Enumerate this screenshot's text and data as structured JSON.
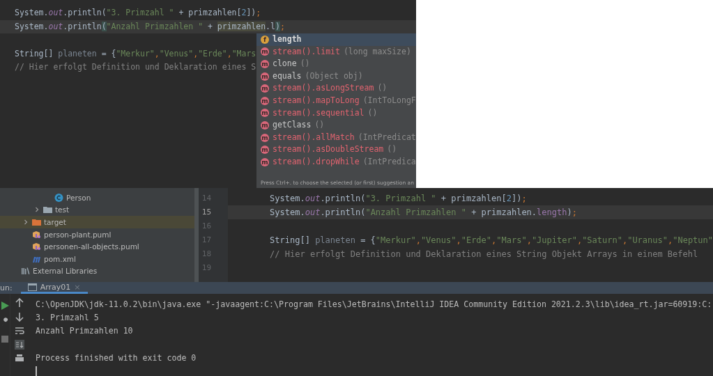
{
  "top_editor": {
    "lines": [
      {
        "current": false,
        "tokens": [
          {
            "t": "System.",
            "kind": "plain"
          },
          {
            "t": "out",
            "kind": "field"
          },
          {
            "t": ".println(",
            "kind": "plain"
          },
          {
            "t": "\"3. Primzahl \"",
            "kind": "string"
          },
          {
            "t": " + primzahlen[",
            "kind": "plain"
          },
          {
            "t": "2",
            "kind": "number"
          },
          {
            "t": "])",
            "kind": "plain"
          },
          {
            "t": ";",
            "kind": "punct"
          }
        ]
      },
      {
        "current": true,
        "tokens": [
          {
            "t": "System.",
            "kind": "plain"
          },
          {
            "t": "out",
            "kind": "field"
          },
          {
            "t": ".println",
            "kind": "plain"
          },
          {
            "t": "(",
            "kind": "brace"
          },
          {
            "t": "\"Anzahl Primzahlen \"",
            "kind": "string"
          },
          {
            "t": " + ",
            "kind": "plain"
          },
          {
            "t": "primzahlen",
            "kind": "highlight"
          },
          {
            "t": ".l",
            "kind": "plain"
          },
          {
            "t": ")",
            "kind": "brace"
          },
          {
            "t": ";",
            "kind": "punct"
          }
        ]
      },
      {
        "current": false
      },
      {
        "current": false,
        "tokens": [
          {
            "t": "String[] ",
            "kind": "plain"
          },
          {
            "t": "planeten",
            "kind": "unused"
          },
          {
            "t": " = {",
            "kind": "plain"
          },
          {
            "t": "\"Merkur\"",
            "kind": "string"
          },
          {
            "t": ",",
            "kind": "punct"
          },
          {
            "t": "\"Venus\"",
            "kind": "string"
          },
          {
            "t": ",",
            "kind": "punct"
          },
          {
            "t": "\"Erde\"",
            "kind": "string"
          },
          {
            "t": ",",
            "kind": "punct"
          },
          {
            "t": "\"Mars",
            "kind": "string"
          }
        ]
      },
      {
        "current": false,
        "tokens": [
          {
            "t": "// Hier erfolgt Definition und Deklaration eines S",
            "kind": "comment"
          }
        ]
      }
    ]
  },
  "completion_popup": {
    "items": [
      {
        "icon": "f",
        "kind": "field",
        "selected": true,
        "name": "length"
      },
      {
        "icon": "m",
        "kind": "stream",
        "selected": false,
        "name": "stream().limit",
        "params": "(long maxSize)"
      },
      {
        "icon": "m",
        "kind": "member",
        "selected": false,
        "name": "clone",
        "params": "()"
      },
      {
        "icon": "m",
        "kind": "member",
        "selected": false,
        "name": "equals",
        "params": "(Object obj)"
      },
      {
        "icon": "m",
        "kind": "stream",
        "selected": false,
        "name": "stream().asLongStream",
        "params": "()"
      },
      {
        "icon": "m",
        "kind": "stream",
        "selected": false,
        "name": "stream().mapToLong",
        "params": "(IntToLongF"
      },
      {
        "icon": "m",
        "kind": "stream",
        "selected": false,
        "name": "stream().sequential",
        "params": "()"
      },
      {
        "icon": "m",
        "kind": "member",
        "selected": false,
        "name": "getClass",
        "params": "()"
      },
      {
        "icon": "m",
        "kind": "stream",
        "selected": false,
        "name": "stream().allMatch",
        "params": "(IntPredicat"
      },
      {
        "icon": "m",
        "kind": "stream",
        "selected": false,
        "name": "stream().asDoubleStream",
        "params": "()"
      },
      {
        "icon": "m",
        "kind": "stream",
        "selected": false,
        "name": "stream().dropWhile",
        "params": "(IntPredica"
      }
    ],
    "hint": "Press Ctrl+. to choose the selected (or first) suggestion an"
  },
  "project_tree": {
    "items": [
      {
        "children": [
          {
            "children": [
              {
                "children": [
                  {
                    "kind": "class",
                    "label": "Person",
                    "selected": false
                  }
                ]
              },
              {
                "kind": "folder",
                "label": "test",
                "selected": false,
                "expanded": false
              }
            ]
          },
          {
            "kind": "excluded_folder",
            "label": "target",
            "selected": true,
            "expanded": false
          },
          {
            "kind": "puml",
            "label": "person-plant.puml",
            "selected": false
          },
          {
            "kind": "puml",
            "label": "personen-all-objects.puml",
            "selected": false
          },
          {
            "kind": "maven",
            "label": "pom.xml",
            "selected": false
          }
        ]
      },
      {
        "kind": "library",
        "label": "External Libraries",
        "selected": false
      }
    ]
  },
  "bottom_editor": {
    "lines": [
      {
        "number": "14",
        "current": false,
        "tokens": [
          {
            "t": "System.",
            "kind": "plain"
          },
          {
            "t": "out",
            "kind": "field"
          },
          {
            "t": ".println(",
            "kind": "plain"
          },
          {
            "t": "\"3. Primzahl \"",
            "kind": "string"
          },
          {
            "t": " + primzahlen[",
            "kind": "plain"
          },
          {
            "t": "2",
            "kind": "number"
          },
          {
            "t": "])",
            "kind": "plain"
          },
          {
            "t": ";",
            "kind": "punct"
          }
        ]
      },
      {
        "number": "15",
        "current": true,
        "tokens": [
          {
            "t": "System.",
            "kind": "plain"
          },
          {
            "t": "out",
            "kind": "field"
          },
          {
            "t": ".println(",
            "kind": "plain"
          },
          {
            "t": "\"Anzahl Primzahlen \"",
            "kind": "string"
          },
          {
            "t": " + primzahlen.",
            "kind": "plain"
          },
          {
            "t": "length",
            "kind": "field_plain"
          },
          {
            "t": ")",
            "kind": "plain"
          },
          {
            "t": ";",
            "kind": "punct"
          }
        ]
      },
      {
        "number": "16",
        "current": false
      },
      {
        "number": "17",
        "current": false,
        "tokens": [
          {
            "t": "String[] ",
            "kind": "plain"
          },
          {
            "t": "planeten",
            "kind": "unused"
          },
          {
            "t": " = {",
            "kind": "plain"
          },
          {
            "t": "\"Merkur\"",
            "kind": "string"
          },
          {
            "t": ",",
            "kind": "punct"
          },
          {
            "t": "\"Venus\"",
            "kind": "string"
          },
          {
            "t": ",",
            "kind": "punct"
          },
          {
            "t": "\"Erde\"",
            "kind": "string"
          },
          {
            "t": ",",
            "kind": "punct"
          },
          {
            "t": "\"Mars\"",
            "kind": "string"
          },
          {
            "t": ",",
            "kind": "punct"
          },
          {
            "t": "\"Jupiter\"",
            "kind": "string"
          },
          {
            "t": ",",
            "kind": "punct"
          },
          {
            "t": "\"Saturn\"",
            "kind": "string"
          },
          {
            "t": ",",
            "kind": "punct"
          },
          {
            "t": "\"Uranus\"",
            "kind": "string"
          },
          {
            "t": ",",
            "kind": "punct"
          },
          {
            "t": "\"Neptun\"",
            "kind": "string"
          }
        ]
      },
      {
        "number": "18",
        "current": false,
        "tokens": [
          {
            "t": "// Hier erfolgt Definition und Deklaration eines String Objekt Arrays in einem Befehl",
            "kind": "comment"
          }
        ]
      },
      {
        "number": "19",
        "current": false
      }
    ]
  },
  "run_panel": {
    "label": "un:",
    "tabs": [
      {
        "label": "Array01",
        "selected": true,
        "close": "×"
      }
    ],
    "console": [
      "C:\\OpenJDK\\jdk-11.0.2\\bin\\java.exe \"-javaagent:C:\\Program Files\\JetBrains\\IntelliJ IDEA Community Edition 2021.2.3\\lib\\idea_rt.jar=60919:C:",
      "3. Primzahl 5",
      "Anzahl Primzahlen 10"
    ],
    "exit_message": "Process finished with exit code 0"
  }
}
